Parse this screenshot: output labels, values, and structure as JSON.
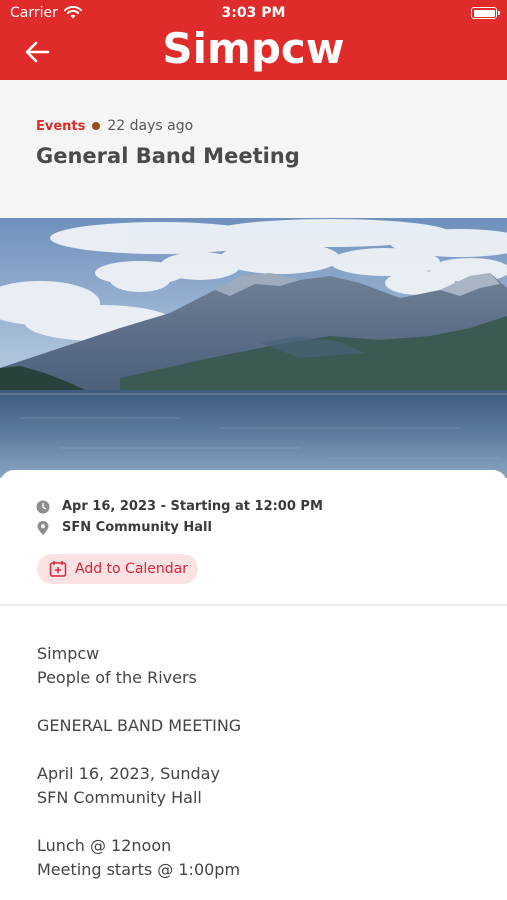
{
  "status_bar": {
    "carrier": "Carrier",
    "time": "3:03 PM"
  },
  "header": {
    "title": "Simpcw",
    "background": "#e02b2b"
  },
  "article": {
    "category": "Events",
    "time_ago": "22 days ago",
    "title": "General Band Meeting",
    "accent": "#e02b2b"
  },
  "event": {
    "date_time": "Apr 16, 2023 - Starting at 12:00 PM",
    "location": "SFN Community Hall",
    "add_to_calendar_label": "Add to Calendar"
  },
  "body": {
    "lines": [
      "Simpcw",
      "People of the Rivers",
      "GENERAL BAND MEETING",
      "April 16, 2023, Sunday",
      "SFN Community Hall",
      "Lunch @ 12noon",
      "Meeting starts @ 1:00pm"
    ]
  },
  "icons": {
    "back": "arrow-left-icon",
    "wifi": "wifi-icon",
    "battery": "battery-icon",
    "clock": "clock-icon",
    "location": "map-pin-icon",
    "calendar": "calendar-plus-icon"
  }
}
